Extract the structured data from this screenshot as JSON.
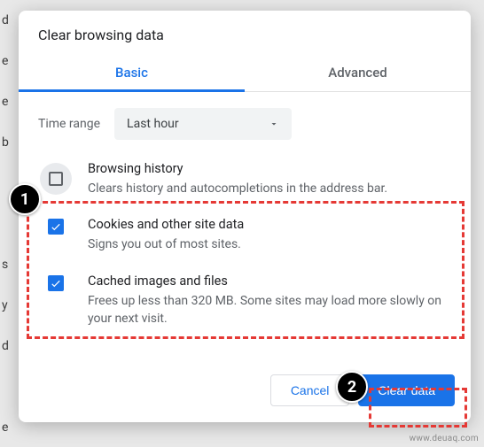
{
  "background": {
    "lines": [
      "d",
      "e",
      "e",
      "b",
      "",
      "",
      "s",
      "y",
      "d",
      "",
      "e"
    ]
  },
  "dialog": {
    "title": "Clear browsing data",
    "tabs": {
      "basic": "Basic",
      "advanced": "Advanced"
    },
    "time_range": {
      "label": "Time range",
      "value": "Last hour"
    },
    "options": {
      "history": {
        "title": "Browsing history",
        "desc": "Clears history and autocompletions in the address bar.",
        "checked": false
      },
      "cookies": {
        "title": "Cookies and other site data",
        "desc": "Signs you out of most sites.",
        "checked": true
      },
      "cache": {
        "title": "Cached images and files",
        "desc": "Frees up less than 320 MB. Some sites may load more slowly on your next visit.",
        "checked": true
      }
    },
    "buttons": {
      "cancel": "Cancel",
      "clear": "Clear data"
    }
  },
  "annotations": {
    "badge1": "1",
    "badge2": "2"
  },
  "watermark": "www.deuaq.com"
}
